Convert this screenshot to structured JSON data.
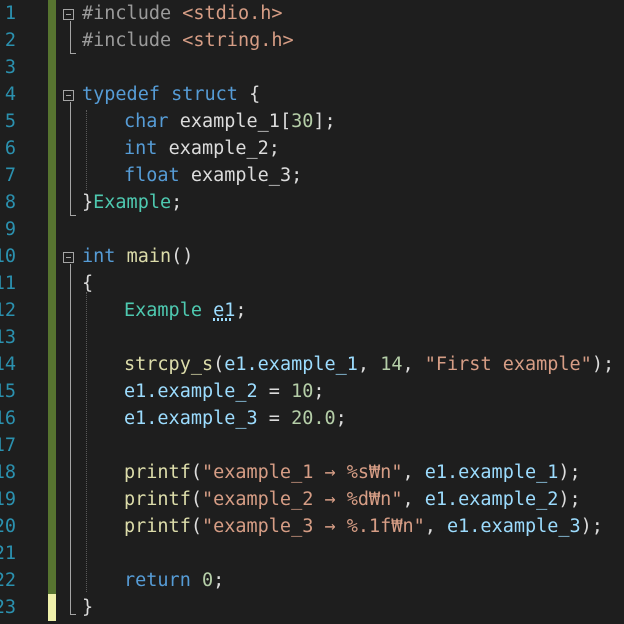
{
  "line_numbers": [
    "1",
    "2",
    "3",
    "4",
    "5",
    "6",
    "7",
    "8",
    "9",
    "10",
    "11",
    "12",
    "13",
    "14",
    "15",
    "16",
    "17",
    "18",
    "19",
    "20",
    "21",
    "22",
    "23"
  ],
  "code": {
    "l1": {
      "pp": "#include ",
      "inc": "<stdio.h>"
    },
    "l2": {
      "pp": "#include ",
      "inc": "<string.h>"
    },
    "l4": {
      "kw1": "typedef",
      "kw2": "struct",
      "brace": "{"
    },
    "l5": {
      "type": "char",
      "name": "example_1[",
      "num": "30",
      "end": "];"
    },
    "l6": {
      "type": "int",
      "name": "example_2;"
    },
    "l7": {
      "type": "float",
      "name": "example_3;"
    },
    "l8": {
      "brace": "}",
      "tname": "Example",
      "end": ";"
    },
    "l10": {
      "type": "int",
      "fn": "main",
      "paren": "()"
    },
    "l11": {
      "brace": "{"
    },
    "l12": {
      "tname": "Example",
      "var": "e1",
      "end": ";"
    },
    "l14": {
      "fn": "strcpy_s",
      "open": "(",
      "arg1": "e1.example_1",
      "sep1": ", ",
      "num": "14",
      "sep2": ", ",
      "str": "\"First example\"",
      "end": ");"
    },
    "l15": {
      "lhs": "e1.example_2",
      "op": " = ",
      "num": "10",
      "end": ";"
    },
    "l16": {
      "lhs": "e1.example_3",
      "op": " = ",
      "num": "20.0",
      "end": ";"
    },
    "l18": {
      "fn": "printf",
      "open": "(",
      "str": "\"example_1 → %s₩n\"",
      "sep": ", ",
      "arg": "e1.example_1",
      "end": ");"
    },
    "l19": {
      "fn": "printf",
      "open": "(",
      "str": "\"example_2 → %d₩n\"",
      "sep": ", ",
      "arg": "e1.example_2",
      "end": ");"
    },
    "l20": {
      "fn": "printf",
      "open": "(",
      "str": "\"example_3 → %.1f₩n\"",
      "sep": ", ",
      "arg": "e1.example_3",
      "end": ");"
    },
    "l22": {
      "kw": "return",
      "num": "0",
      "end": ";"
    },
    "l23": {
      "brace": "}"
    }
  },
  "colors": {
    "background": "#1e1e1e",
    "line_number": "#2b91af",
    "keyword": "#569cd6",
    "type": "#4ec9b0",
    "string": "#d69d85",
    "number": "#b5cea8",
    "function": "#dcdcaa",
    "variable": "#9cdcfe",
    "change_saved": "#577430",
    "change_unsaved": "#eff0ab"
  }
}
